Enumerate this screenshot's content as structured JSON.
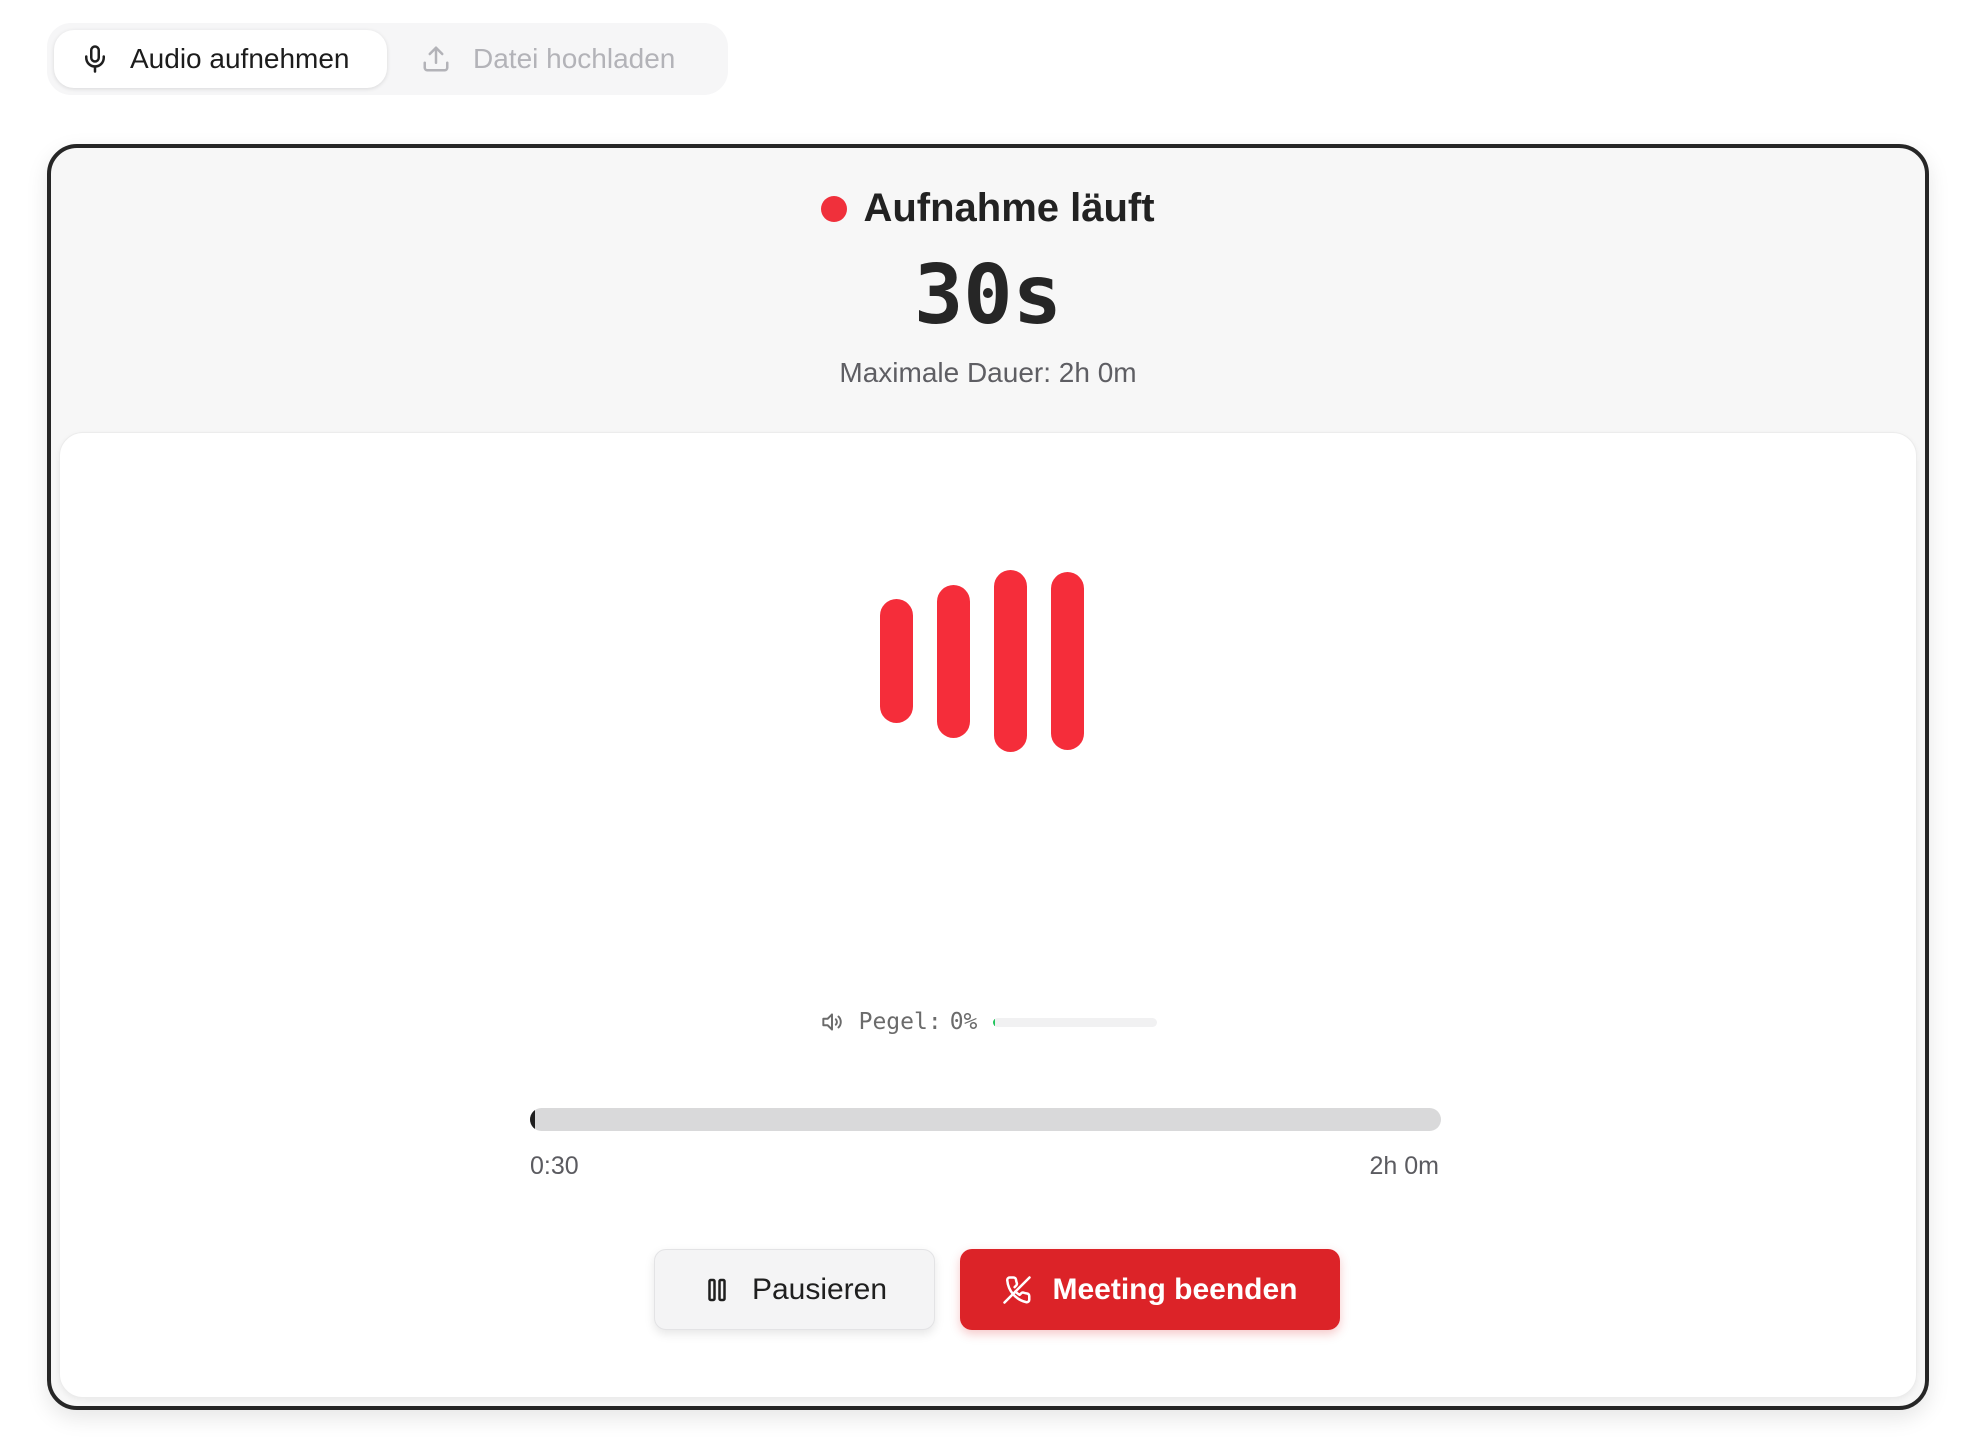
{
  "tabs": {
    "record": {
      "label": "Audio aufnehmen",
      "icon": "microphone-icon",
      "active": true
    },
    "upload": {
      "label": "Datei hochladen",
      "icon": "upload-icon",
      "active": false
    }
  },
  "recording": {
    "status": "Aufnahme läuft",
    "elapsed": "30s",
    "max_duration": "Maximale Dauer: 2h 0m",
    "status_color": "#f0303b"
  },
  "level": {
    "icon": "speaker-icon",
    "label": "Pegel:",
    "value": "0%",
    "fraction": 0.01
  },
  "progress": {
    "current": "0:30",
    "total": "2h 0m",
    "fraction": 0.0042
  },
  "waveform": {
    "color": "#f52d3a",
    "levels": [
      0.68,
      0.84,
      1.0,
      0.98
    ]
  },
  "buttons": {
    "pause": {
      "label": "Pausieren",
      "icon": "pause-icon"
    },
    "end": {
      "label": "Meeting beenden",
      "icon": "phone-off-icon",
      "color": "#dc2328"
    }
  }
}
